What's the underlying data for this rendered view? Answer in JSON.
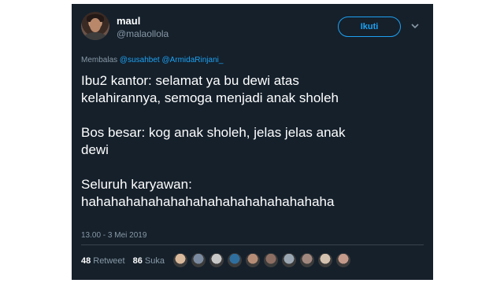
{
  "tweet": {
    "author_name": "maul",
    "author_handle": "@malaollola",
    "follow_label": "Ikuti",
    "reply_prefix": "Membalas",
    "reply_mentions": [
      "@susahbet",
      "@ArmidaRinjani_"
    ],
    "paragraphs": [
      "Ibu2 kantor: selamat ya bu dewi atas\nkelahirannya, semoga menjadi anak sholeh",
      "Bos besar: kog anak sholeh, jelas jelas anak\ndewi",
      "Seluruh karyawan:\nhahahahahahahahahahahahahahahahaha"
    ],
    "timestamp": "13.00 - 3 Mei 2019",
    "retweet_count": "48",
    "retweet_label": "Retweet",
    "like_count": "86",
    "like_label": "Suka"
  },
  "icons": {
    "more": "chevron-down-icon",
    "avatar": "user-avatar"
  },
  "colors": {
    "background": "#15202b",
    "accent": "#1da1f2",
    "muted": "#8899a6",
    "divider": "#38444d"
  },
  "liker_avatars": [
    "#d9b99b",
    "#7a8aa0",
    "#c7c7c7",
    "#2f6f9f",
    "#b58d76",
    "#8d6e63",
    "#9aa7b3",
    "#a1887f",
    "#d4c2b0",
    "#c49a8a"
  ]
}
